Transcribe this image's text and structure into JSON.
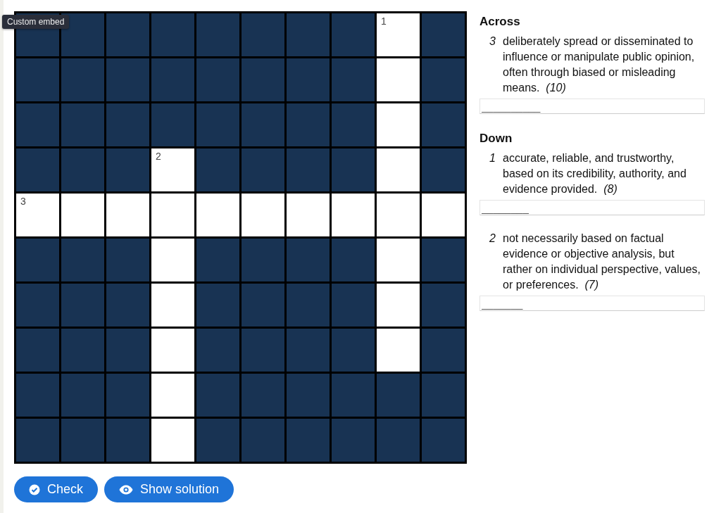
{
  "tooltip": "Custom embed",
  "grid": {
    "rows": [
      [
        {
          "kind": "block"
        },
        {
          "kind": "block"
        },
        {
          "kind": "block"
        },
        {
          "kind": "block"
        },
        {
          "kind": "block"
        },
        {
          "kind": "block"
        },
        {
          "kind": "block"
        },
        {
          "kind": "block"
        },
        {
          "kind": "open",
          "number": "1"
        },
        {
          "kind": "block"
        }
      ],
      [
        {
          "kind": "block"
        },
        {
          "kind": "block"
        },
        {
          "kind": "block"
        },
        {
          "kind": "block"
        },
        {
          "kind": "block"
        },
        {
          "kind": "block"
        },
        {
          "kind": "block"
        },
        {
          "kind": "block"
        },
        {
          "kind": "open"
        },
        {
          "kind": "block"
        }
      ],
      [
        {
          "kind": "block"
        },
        {
          "kind": "block"
        },
        {
          "kind": "block"
        },
        {
          "kind": "block"
        },
        {
          "kind": "block"
        },
        {
          "kind": "block"
        },
        {
          "kind": "block"
        },
        {
          "kind": "block"
        },
        {
          "kind": "open"
        },
        {
          "kind": "block"
        }
      ],
      [
        {
          "kind": "block"
        },
        {
          "kind": "block"
        },
        {
          "kind": "block"
        },
        {
          "kind": "open",
          "number": "2"
        },
        {
          "kind": "block"
        },
        {
          "kind": "block"
        },
        {
          "kind": "block"
        },
        {
          "kind": "block"
        },
        {
          "kind": "open"
        },
        {
          "kind": "block"
        }
      ],
      [
        {
          "kind": "open",
          "number": "3"
        },
        {
          "kind": "open"
        },
        {
          "kind": "open"
        },
        {
          "kind": "open"
        },
        {
          "kind": "open"
        },
        {
          "kind": "open"
        },
        {
          "kind": "open"
        },
        {
          "kind": "open"
        },
        {
          "kind": "open"
        },
        {
          "kind": "open"
        }
      ],
      [
        {
          "kind": "block"
        },
        {
          "kind": "block"
        },
        {
          "kind": "block"
        },
        {
          "kind": "open"
        },
        {
          "kind": "block"
        },
        {
          "kind": "block"
        },
        {
          "kind": "block"
        },
        {
          "kind": "block"
        },
        {
          "kind": "open"
        },
        {
          "kind": "block"
        }
      ],
      [
        {
          "kind": "block"
        },
        {
          "kind": "block"
        },
        {
          "kind": "block"
        },
        {
          "kind": "open"
        },
        {
          "kind": "block"
        },
        {
          "kind": "block"
        },
        {
          "kind": "block"
        },
        {
          "kind": "block"
        },
        {
          "kind": "open"
        },
        {
          "kind": "block"
        }
      ],
      [
        {
          "kind": "block"
        },
        {
          "kind": "block"
        },
        {
          "kind": "block"
        },
        {
          "kind": "open"
        },
        {
          "kind": "block"
        },
        {
          "kind": "block"
        },
        {
          "kind": "block"
        },
        {
          "kind": "block"
        },
        {
          "kind": "open"
        },
        {
          "kind": "block"
        }
      ],
      [
        {
          "kind": "block"
        },
        {
          "kind": "block"
        },
        {
          "kind": "block"
        },
        {
          "kind": "open"
        },
        {
          "kind": "block"
        },
        {
          "kind": "block"
        },
        {
          "kind": "block"
        },
        {
          "kind": "block"
        },
        {
          "kind": "block"
        },
        {
          "kind": "block"
        }
      ],
      [
        {
          "kind": "block"
        },
        {
          "kind": "block"
        },
        {
          "kind": "block"
        },
        {
          "kind": "open"
        },
        {
          "kind": "block"
        },
        {
          "kind": "block"
        },
        {
          "kind": "block"
        },
        {
          "kind": "block"
        },
        {
          "kind": "block"
        },
        {
          "kind": "block"
        }
      ]
    ]
  },
  "clue_groups": [
    {
      "heading": "Across",
      "clues": [
        {
          "number": "3",
          "text": "deliberately spread or disseminated to influence or manipulate public opinion, often through biased or misleading means.",
          "length": "(10)",
          "placeholder": "__________"
        }
      ]
    },
    {
      "heading": "Down",
      "clues": [
        {
          "number": "1",
          "text": "accurate, reliable, and trustworthy, based on its credibility, authority, and evidence provided.",
          "length": "(8)",
          "placeholder": "________"
        },
        {
          "number": "2",
          "text": "not necessarily based on factual evidence or objective analysis, but rather on individual perspective, values, or preferences.",
          "length": "(7)",
          "placeholder": "_______"
        }
      ]
    }
  ],
  "buttons": [
    {
      "kind": "check",
      "label": "Check"
    },
    {
      "kind": "solution",
      "label": "Show solution"
    }
  ]
}
